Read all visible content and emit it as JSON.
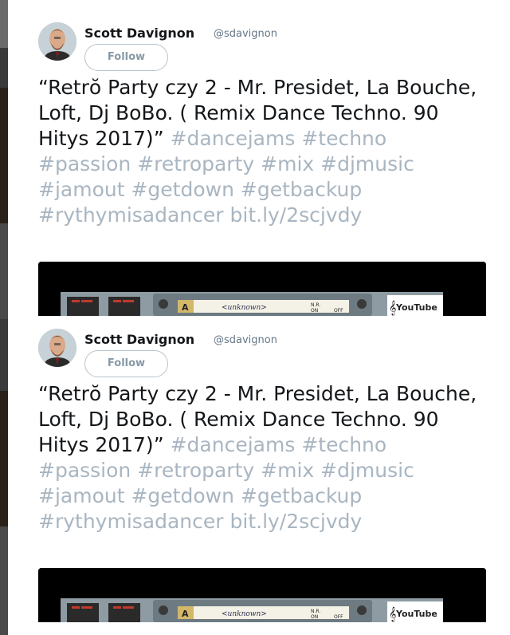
{
  "tweets": [
    {
      "author_name": "Scott Davignon",
      "author_handle": "@sdavignon",
      "follow_label": "Follow",
      "text": "“Retrŏ Party czy 2 - Mr. Presidet, La Bouche, Loft, Dj BoBo. ( Remix Dance Techno. 90 Hitys 2017)”",
      "hashtags": [
        "#dancejams",
        "#techno",
        "#passion",
        "#retroparty",
        "#mix",
        "#djmusic",
        "#jamout",
        "#getdown",
        "#getbackup",
        "#rythymisadancer"
      ],
      "link": "bit.ly/2scjvdy",
      "media": {
        "deck_label": "A",
        "track": "<unknown>",
        "nr_label": "N.R.",
        "on_label": "ON",
        "off_label": "OFF",
        "logo": "YouTube"
      }
    },
    {
      "author_name": "Scott Davignon",
      "author_handle": "@sdavignon",
      "follow_label": "Follow",
      "text": "“Retrŏ Party czy 2 - Mr. Presidet, La Bouche, Loft, Dj BoBo. ( Remix Dance Techno. 90 Hitys 2017)”",
      "hashtags": [
        "#dancejams",
        "#techno",
        "#passion",
        "#retroparty",
        "#mix",
        "#djmusic",
        "#jamout",
        "#getdown",
        "#getbackup",
        "#rythymisadancer"
      ],
      "link": "bit.ly/2scjvdy",
      "media": {
        "deck_label": "A",
        "track": "<unknown>",
        "nr_label": "N.R.",
        "on_label": "ON",
        "off_label": "OFF",
        "logo": "YouTube"
      }
    }
  ],
  "colors": {
    "link": "#a9b6c1",
    "text": "#14171a",
    "handle": "#657786"
  }
}
